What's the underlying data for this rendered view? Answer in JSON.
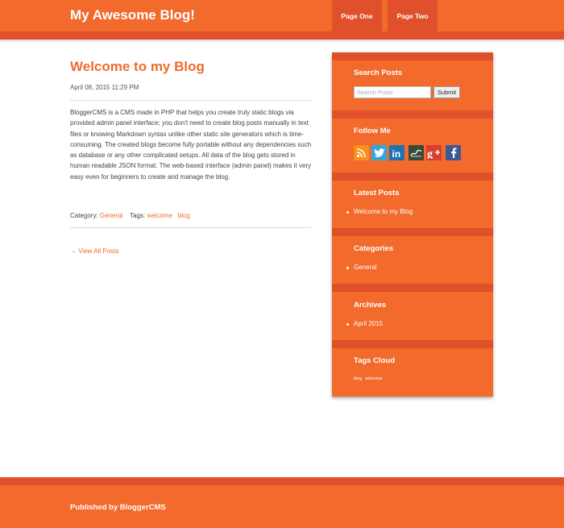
{
  "header": {
    "site_title": "My Awesome Blog!",
    "nav": [
      "Page One",
      "Page Two"
    ]
  },
  "post": {
    "title": "Welcome to my Blog",
    "date": "April 08, 2015 11:29 PM",
    "body": "BloggerCMS is a CMS made in PHP that helps you create truly static blogs via provided admin panel interface; you don't need to create blog posts manually in text files or knowing Markdown syntax unlike other static site generators which is time-consuming. The created blogs become fully portable without any dependencies such as database or any other complicated setups. All data of the blog gets stored in human readable JSON format. The web-based interface (admin panel) makes it very easy even for beginners to create and manage the blog.",
    "category_label": "Category:",
    "category": "General",
    "tags_label": "Tags:",
    "tags": [
      "welcome",
      "blog"
    ],
    "view_all": "→ View All Posts"
  },
  "sidebar": {
    "search": {
      "title": "Search Posts",
      "placeholder": "Search Posts",
      "button": "Submit"
    },
    "follow": {
      "title": "Follow Me",
      "icons": [
        "rss-icon",
        "twitter-icon",
        "linkedin-icon",
        "blog-icon",
        "google-plus-icon",
        "facebook-icon"
      ],
      "colors": {
        "rss": "#f7901e",
        "twitter": "#2fa8e0",
        "linkedin": "#1d74b0",
        "blog": "#3a4a3a",
        "google_plus": "#d6402f",
        "facebook": "#3b5998"
      }
    },
    "latest": {
      "title": "Latest Posts",
      "items": [
        "Welcome to my Blog"
      ]
    },
    "categories": {
      "title": "Categories",
      "items": [
        "General"
      ]
    },
    "archives": {
      "title": "Archives",
      "items": [
        "April 2015"
      ]
    },
    "tags_cloud": {
      "title": "Tags Cloud",
      "items": [
        "blog",
        "welcome"
      ]
    }
  },
  "footer": {
    "text": "Published by BloggerCMS"
  },
  "theme": {
    "accent": "#f26a2c",
    "accent_dark": "#e0502a"
  }
}
